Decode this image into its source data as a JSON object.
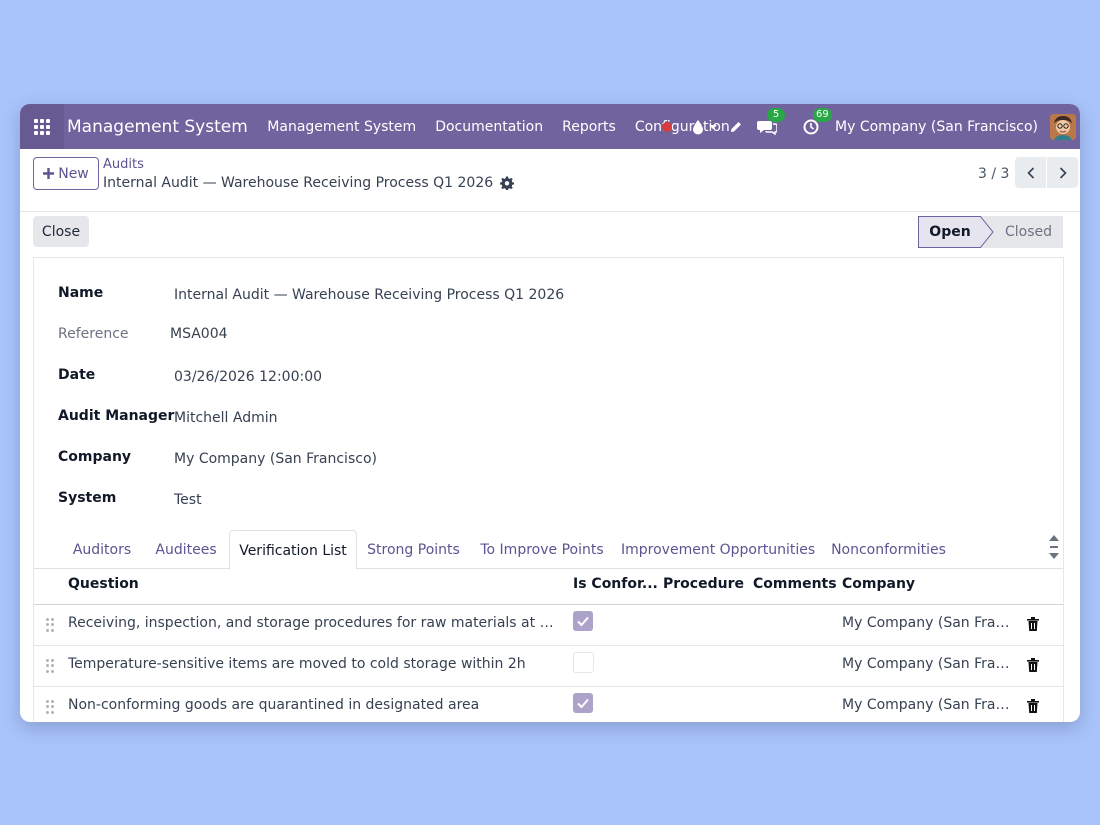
{
  "navbar": {
    "brand": "Management System",
    "menu": [
      "Management System",
      "Documentation",
      "Reports",
      "Configuration"
    ],
    "messages_count": "5",
    "activities_count": "69",
    "company": "My Company (San Francisco)"
  },
  "control_panel": {
    "new_label": "New",
    "breadcrumb_parent": "Audits",
    "breadcrumb_current": "Internal Audit — Warehouse Receiving Process Q1 2026",
    "pager": "3 / 3"
  },
  "statusbar": {
    "close_label": "Close",
    "stages": [
      "Open",
      "Closed"
    ],
    "active_stage": "Open"
  },
  "form": {
    "name_label": "Name",
    "name_value": "Internal Audit — Warehouse Receiving Process Q1 2026",
    "reference_label": "Reference",
    "reference_value": "MSA004",
    "date_label": "Date",
    "date_value": "03/26/2026 12:00:00",
    "manager_label": "Audit Manager",
    "manager_value": "Mitchell Admin",
    "company_label": "Company",
    "company_value": "My Company (San Francisco)",
    "system_label": "System",
    "system_value": "Test"
  },
  "tabs": [
    "Auditors",
    "Auditees",
    "Verification List",
    "Strong Points",
    "To Improve Points",
    "Improvement Opportunities",
    "Nonconformities"
  ],
  "active_tab": "Verification List",
  "table": {
    "headers": [
      "Question",
      "Is Confor...",
      "Procedure",
      "Comments",
      "Company"
    ],
    "rows": [
      {
        "question": "Receiving, inspection, and storage procedures for raw materials at Warehouse A",
        "conforming": true,
        "procedure": "",
        "comments": "",
        "company": "My Company (San Francis..."
      },
      {
        "question": "Temperature-sensitive items are moved to cold storage within 2h",
        "conforming": false,
        "procedure": "",
        "comments": "",
        "company": "My Company (San Francis..."
      },
      {
        "question": "Non-conforming goods are quarantined in designated area",
        "conforming": true,
        "procedure": "",
        "comments": "",
        "company": "My Company (San Francis..."
      }
    ]
  },
  "colors": {
    "navbar": "#71639e",
    "accent": "#5e5390",
    "background": "#a9c4fb",
    "checkbox_checked": "#aba3c9",
    "badge": "#28a745"
  }
}
